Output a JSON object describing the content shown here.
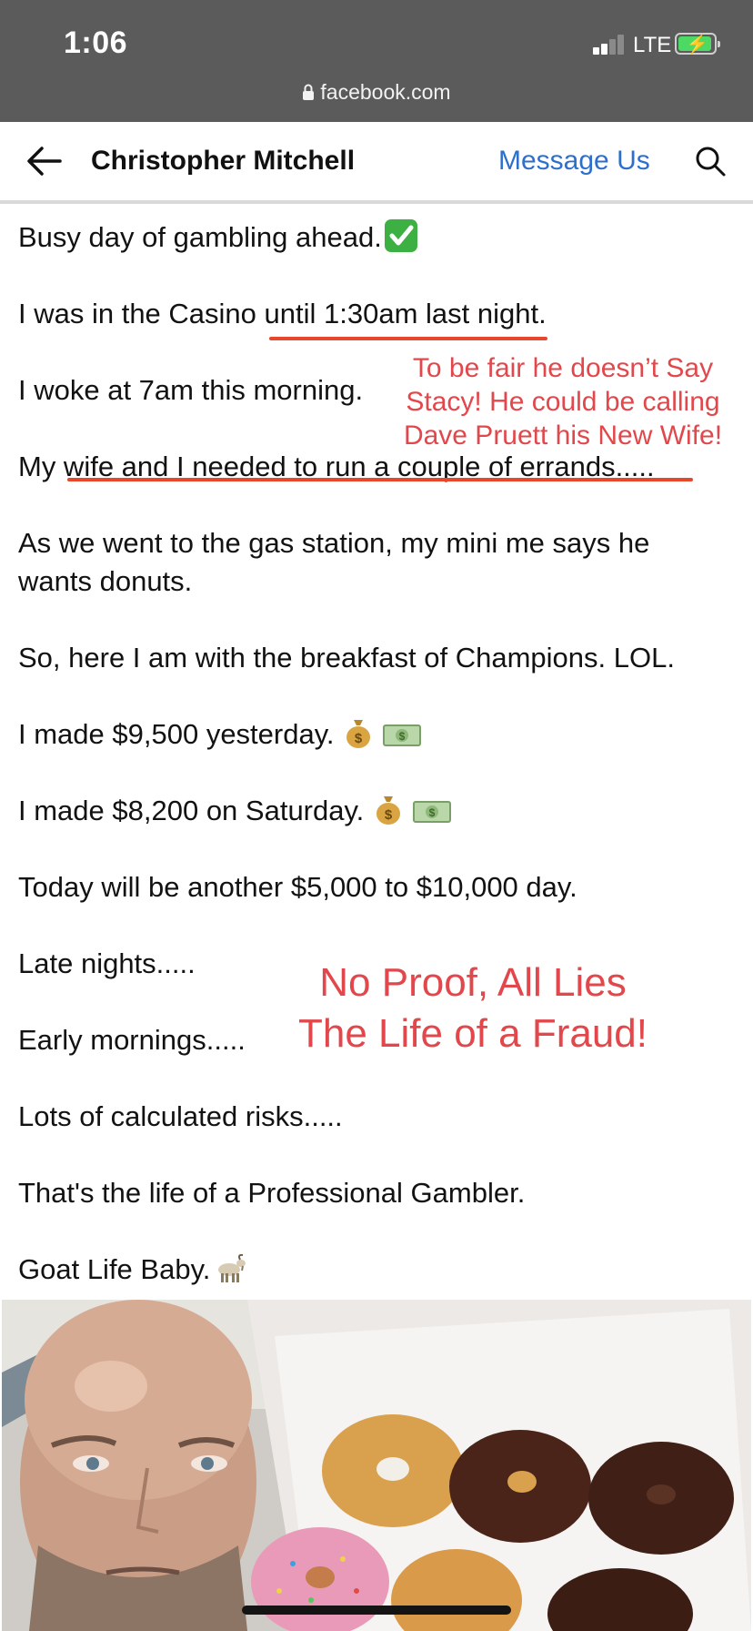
{
  "status_bar": {
    "time": "1:06",
    "network": "LTE",
    "url": "facebook.com"
  },
  "header": {
    "page_name": "Christopher Mitchell",
    "message_button": "Message Us"
  },
  "post": {
    "lines": [
      "Busy day of gambling ahead.",
      "I was in the Casino until 1:30am last night.",
      "I woke at 7am this morning.",
      "My wife and I needed to run a couple of errands.....",
      "As we went to the gas station, my mini me says he",
      "wants donuts.",
      "So, here I am with the breakfast of Champions. LOL.",
      "I made $9,500 yesterday.",
      "I made $8,200 on Saturday.",
      "Today will be another $5,000 to $10,000 day.",
      "Late nights.....",
      "Early mornings.....",
      "Lots of calculated risks.....",
      "That's the life of a Professional Gambler.",
      "Goat Life Baby."
    ]
  },
  "annotations": {
    "top_note": [
      "To be fair he doesn’t Say",
      "Stacy! He could be calling",
      "Dave Pruett his New Wife!"
    ],
    "middle_note": [
      "No Proof, All Lies",
      "The Life of a Fraud!"
    ]
  },
  "icons": [
    "back-arrow-icon",
    "search-icon",
    "lock-icon",
    "check-mark-emoji",
    "money-bag-emoji",
    "dollar-banknote-emoji",
    "goat-emoji"
  ],
  "colors": {
    "status_bar": "#5b5b5b",
    "link_blue": "#2d6fcb",
    "annotation_red": "#e2474b",
    "underline_red": "#e5482d"
  }
}
